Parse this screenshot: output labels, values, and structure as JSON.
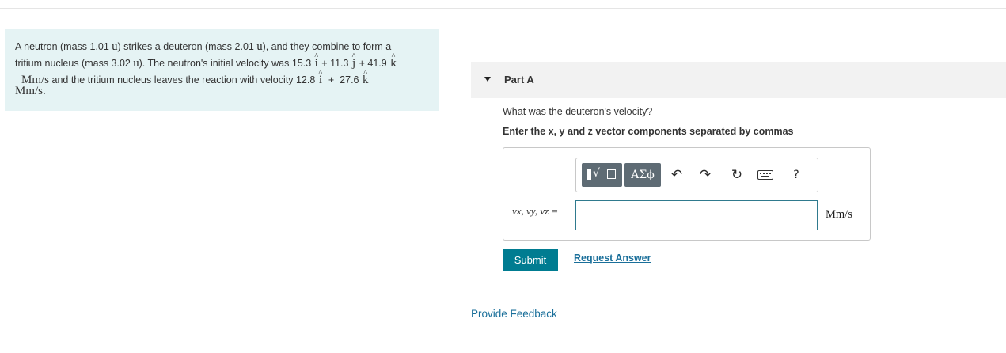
{
  "problem": {
    "line1": {
      "text_a": "A neutron (mass 1.01 ",
      "unit_a": "u",
      "text_b": ") strikes a deuteron (mass 2.01 ",
      "unit_b": "u",
      "text_c": "), and they combine to form a"
    },
    "line2": {
      "text_a": "tritium nucleus (mass 3.02 ",
      "unit_a": "u",
      "text_b": "). The neutron's initial velocity was  ",
      "vx": "15.3",
      "i": "i",
      "plus1": " + 11.3 ",
      "j": "j",
      "plus2": " + 41.9 ",
      "k": "k"
    },
    "line3": {
      "unit": "Mm/s",
      "text_a": " and the tritium nucleus leaves the reaction with velocity  ",
      "vx": "12.8",
      "i": "i",
      "plus": "  +  27.6 ",
      "k": "k"
    },
    "line4": {
      "unit": "Mm/s."
    }
  },
  "part": {
    "title": "Part A",
    "question": "What was the deuteron's velocity?",
    "instruction": "Enter the x, y and z vector components separated by commas"
  },
  "toolbar": {
    "templates_icon": "radical-template-icon",
    "greek_label": "ΑΣϕ",
    "undo_icon": "undo-icon",
    "redo_icon": "redo-icon",
    "reset_icon": "reset-icon",
    "keyboard_icon": "keyboard-icon",
    "help_label": "?"
  },
  "answer": {
    "variable_label": "vx, vy, vz =",
    "input_value": "",
    "unit": "Mm/s"
  },
  "buttons": {
    "submit": "Submit",
    "request_answer": "Request Answer",
    "provide_feedback": "Provide Feedback"
  },
  "colors": {
    "problem_bg": "#e5f3f4",
    "submit_bg": "#007c91",
    "link": "#1a6f9a",
    "input_border": "#2f7a8e"
  }
}
